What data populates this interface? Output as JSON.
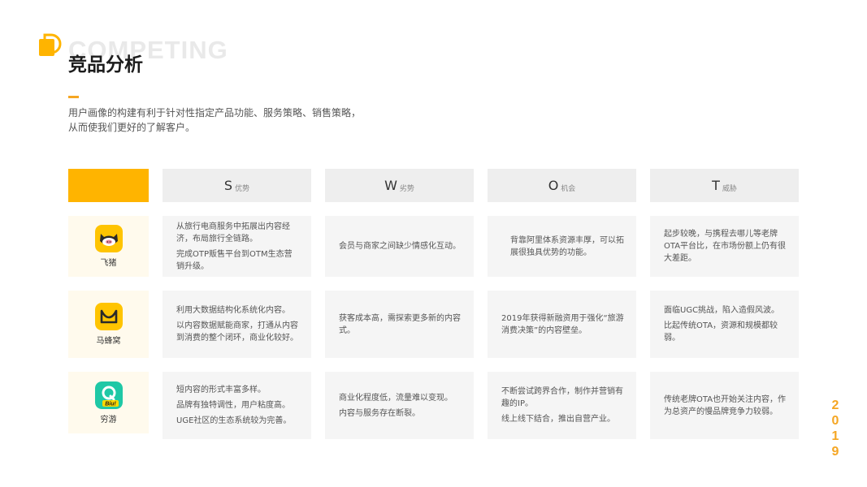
{
  "header": {
    "bg_title": "COMPETING",
    "title": "竞品分析",
    "desc_lines": [
      "用户画像的构建有利于针对性指定产品功能、服务策略、销售策略，",
      "从而使我们更好的了解客户。"
    ]
  },
  "colors": {
    "accent": "#f5a623",
    "header_yellow": "#ffb400",
    "cell_bg": "#f5f5f5",
    "brand_bg": "#fffaed"
  },
  "swot": [
    {
      "letter": "S",
      "label": "优势"
    },
    {
      "letter": "W",
      "label": "劣势"
    },
    {
      "letter": "O",
      "label": "机会"
    },
    {
      "letter": "T",
      "label": "威胁"
    }
  ],
  "rows": [
    {
      "brand": "飞猪",
      "icon": "fliggy-pig-icon",
      "cells": [
        [
          "从旅行电商服务中拓展出内容经济，布局旅行全链路。",
          "完成OTP贩售平台到OTM生态营销升级。"
        ],
        [
          "会员与商家之间缺少情感化互动。"
        ],
        [
          "背靠阿里体系资源丰厚，可以拓展很独具优势的功能。"
        ],
        [
          "起步较晚，与携程去哪儿等老牌OTA平台比，在市场份额上仍有很大差距。"
        ]
      ]
    },
    {
      "brand": "马蜂窝",
      "icon": "mafengwo-m-icon",
      "cells": [
        [
          "利用大数据结构化系统化内容。",
          "以内容数据赋能商家，打通从内容到消费的整个闭环，商业化较好。"
        ],
        [
          "获客成本高，需探索更多新的内容式。"
        ],
        [
          "2019年获得新融资用于强化“旅游消费决策”的内容壁垒。"
        ],
        [
          "面临UGC挑战，陷入造假风波。",
          "比起传统OTA，资源和规模都较弱。"
        ]
      ]
    },
    {
      "brand": "穷游",
      "icon": "qyer-q-icon",
      "icon_text": "Biu!",
      "cells": [
        [
          "短内容的形式丰富多样。",
          "品牌有独特调性，用户粘度高。",
          "UGE社区的生态系统较为完善。"
        ],
        [
          "商业化程度低，流量难以变现。",
          "内容与服务存在断裂。"
        ],
        [
          "不断尝试跨界合作，制作并营销有趣的IP。",
          "线上线下结合，推出自营产业。"
        ],
        [
          "传统老牌OTA也开始关注内容，作为总资产的慢品牌竞争力较弱。"
        ]
      ]
    }
  ],
  "year_digits": [
    "2",
    "0",
    "1",
    "9"
  ]
}
